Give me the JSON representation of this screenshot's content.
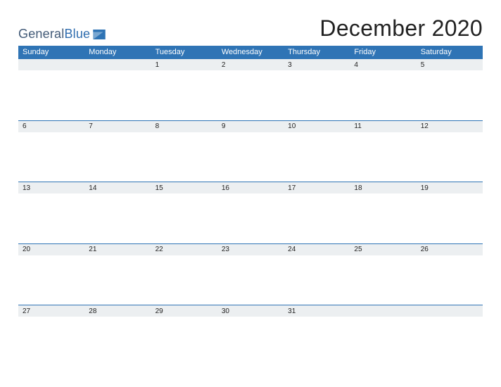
{
  "brand": {
    "name_part1": "General",
    "name_part2": "Blue"
  },
  "title": "December 2020",
  "weekdays": [
    "Sunday",
    "Monday",
    "Tuesday",
    "Wednesday",
    "Thursday",
    "Friday",
    "Saturday"
  ],
  "weeks": [
    [
      "",
      "",
      "1",
      "2",
      "3",
      "4",
      "5"
    ],
    [
      "6",
      "7",
      "8",
      "9",
      "10",
      "11",
      "12"
    ],
    [
      "13",
      "14",
      "15",
      "16",
      "17",
      "18",
      "19"
    ],
    [
      "20",
      "21",
      "22",
      "23",
      "24",
      "25",
      "26"
    ],
    [
      "27",
      "28",
      "29",
      "30",
      "31",
      "",
      ""
    ]
  ],
  "colors": {
    "primary": "#2f74b5",
    "band": "#eceff1"
  }
}
